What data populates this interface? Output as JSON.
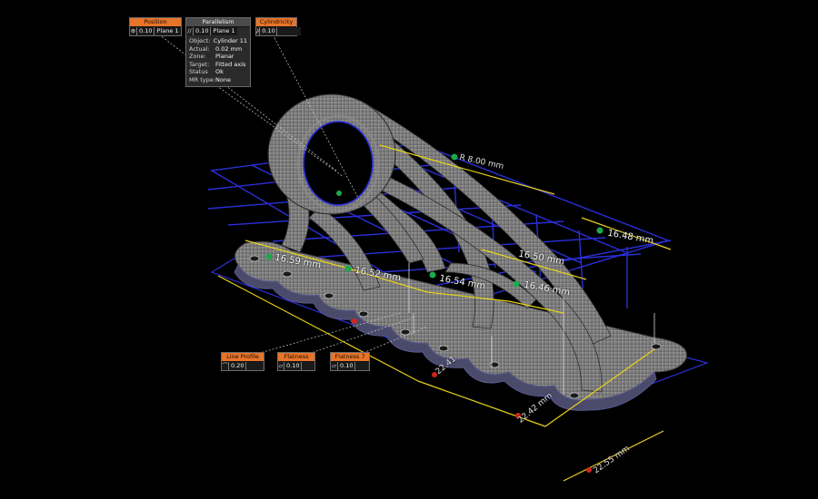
{
  "annotations": {
    "position": {
      "title": "Position",
      "symbol": "⊕",
      "tolerance": "0.10",
      "reference": "Plane 1"
    },
    "parallelism": {
      "title": "Parallelism",
      "symbol": "//",
      "tolerance": "0.10",
      "reference": "Plane 1",
      "rows": [
        {
          "key": "Object:",
          "value": "Cylinder 11"
        },
        {
          "key": "Actual:",
          "value": "0.02 mm"
        },
        {
          "key": "Zone:",
          "value": "Planar"
        },
        {
          "key": "Target:",
          "value": "Fitted axis"
        },
        {
          "key": "Status",
          "value": "Ok"
        },
        {
          "key": "MR type:",
          "value": "None"
        }
      ]
    },
    "cylindricity": {
      "title": "Cylindricity",
      "symbol": "/⁄",
      "tolerance": "0.10"
    },
    "line_profile": {
      "title": "Line Profile",
      "symbol": "⌒",
      "tolerance": "0.20"
    },
    "flatness": {
      "title": "Flatness",
      "symbol": "▱",
      "tolerance": "0.10"
    },
    "flatness7": {
      "title": "Flatness 7",
      "symbol": "▱",
      "tolerance": "0.10"
    }
  },
  "dimensions": {
    "radius": "R 8.00 mm",
    "d1": "16.59 mm",
    "d2": "16.52 mm",
    "d3": "16.54 mm",
    "d4": "16.46 mm",
    "d5": "16.48 mm",
    "d6": "16.50 mm",
    "d7": "22.41",
    "d8": "22.42 mm",
    "d9": "22.55 mm"
  },
  "colors": {
    "grid": "#2b2fd8",
    "annotation_header": "#e8742a",
    "dimension_line": "#e8d21a",
    "part": "#8a8a8a"
  }
}
